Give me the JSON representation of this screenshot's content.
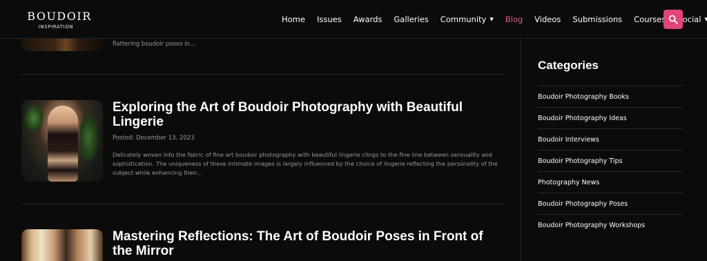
{
  "logo": {
    "main": "BOUDOIR",
    "sub": "INSPIRATION"
  },
  "nav": {
    "items": [
      {
        "label": "Home",
        "dropdown": false,
        "active": false
      },
      {
        "label": "Issues",
        "dropdown": false,
        "active": false
      },
      {
        "label": "Awards",
        "dropdown": false,
        "active": false
      },
      {
        "label": "Galleries",
        "dropdown": false,
        "active": false
      },
      {
        "label": "Community",
        "dropdown": true,
        "active": false
      },
      {
        "label": "Blog",
        "dropdown": false,
        "active": true
      },
      {
        "label": "Videos",
        "dropdown": false,
        "active": false
      },
      {
        "label": "Submissions",
        "dropdown": false,
        "active": false
      },
      {
        "label": "Courses",
        "dropdown": false,
        "active": false
      },
      {
        "label": "Social",
        "dropdown": true,
        "active": false
      }
    ],
    "caret_glyph": "▼",
    "search_icon": "search-icon"
  },
  "colors": {
    "accent": "#e2447a",
    "active_link": "#e05a86",
    "background": "#0b0b0b",
    "muted_text": "#9a9a9a"
  },
  "posts": {
    "partial_excerpt": "flattering boudoir poses in...",
    "items": [
      {
        "title": "Exploring the Art of Boudoir Photography with Beautiful Lingerie",
        "date": "Posted: December 13, 2023",
        "excerpt": "Delicately woven into the fabric of fine art boudoir photography with beautiful lingerie clings to the fine line between sensuality and sophistication. The uniqueness of these intimate images is largely influenced by the choice of lingerie reflecting the personality of the subject while enhancing their..."
      },
      {
        "title": "Mastering Reflections: The Art of Boudoir Poses in Front of the Mirror"
      }
    ]
  },
  "sidebar": {
    "title": "Categories",
    "categories": [
      "Boudoir Photography Books",
      "Boudoir Photography Ideas",
      "Boudoir Interviews",
      "Boudoir Photography Tips",
      "Photography News",
      "Boudoir Photography Poses",
      "Boudoir Photography Workshops"
    ]
  }
}
